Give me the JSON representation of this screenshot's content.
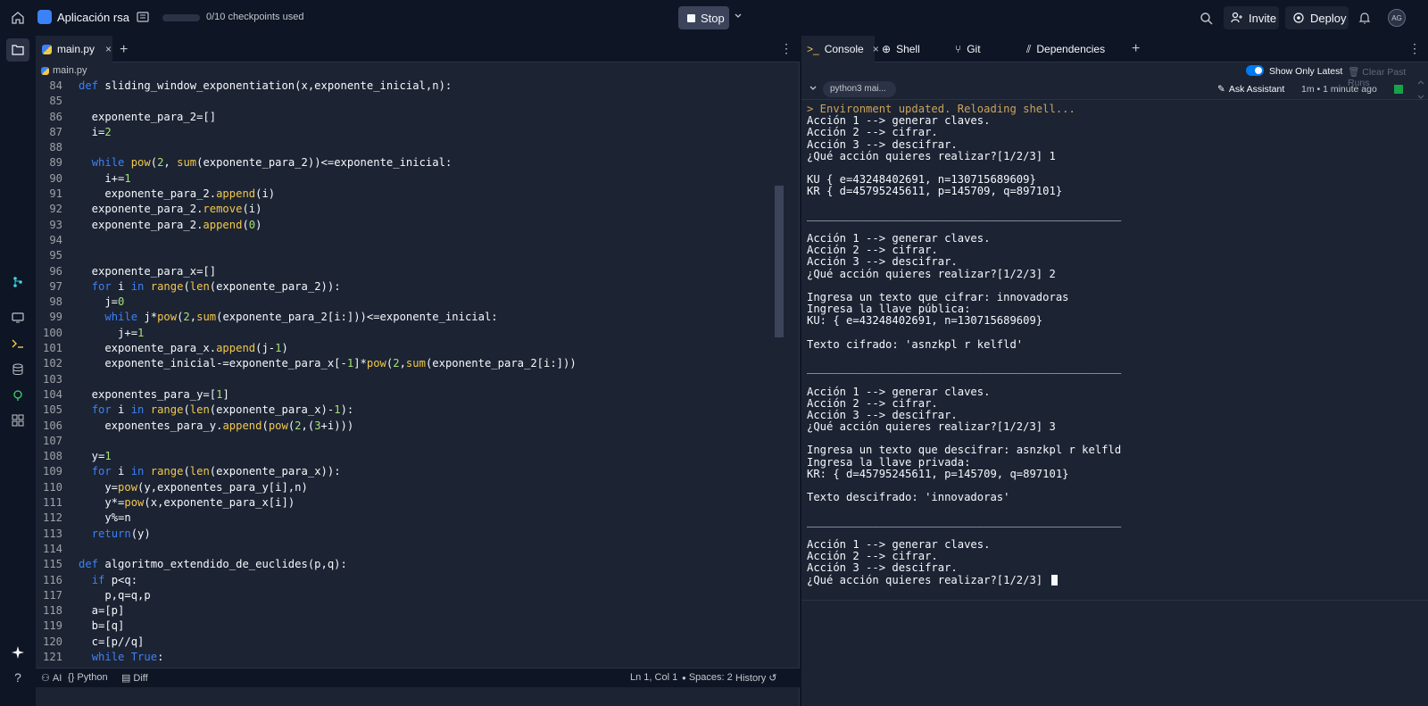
{
  "top": {
    "app_name": "Aplicación rsa",
    "checkpoints": "0/10 checkpoints used",
    "stop": "Stop",
    "invite": "Invite",
    "deploy": "Deploy",
    "avatar": "AG"
  },
  "editor": {
    "tab": "main.py",
    "breadcrumb": "main.py",
    "status": {
      "ai": "AI",
      "lang": "Python",
      "diff": "Diff",
      "position": "Ln 1, Col 1",
      "spaces": "Spaces: 2",
      "history": "History"
    },
    "lines": [
      {
        "n": "84",
        "t": "def sliding_window_exponentiation(x,exponente_inicial,n):"
      },
      {
        "n": "85",
        "t": ""
      },
      {
        "n": "86",
        "t": "  exponente_para_2=[]"
      },
      {
        "n": "87",
        "t": "  i=2"
      },
      {
        "n": "88",
        "t": ""
      },
      {
        "n": "89",
        "t": "  while pow(2, sum(exponente_para_2))<=exponente_inicial:"
      },
      {
        "n": "90",
        "t": "    i+=1"
      },
      {
        "n": "91",
        "t": "    exponente_para_2.append(i)"
      },
      {
        "n": "92",
        "t": "  exponente_para_2.remove(i)"
      },
      {
        "n": "93",
        "t": "  exponente_para_2.append(0)"
      },
      {
        "n": "94",
        "t": ""
      },
      {
        "n": "95",
        "t": ""
      },
      {
        "n": "96",
        "t": "  exponente_para_x=[]"
      },
      {
        "n": "97",
        "t": "  for i in range(len(exponente_para_2)):"
      },
      {
        "n": "98",
        "t": "    j=0"
      },
      {
        "n": "99",
        "t": "    while j*pow(2,sum(exponente_para_2[i:]))<=exponente_inicial:"
      },
      {
        "n": "100",
        "t": "      j+=1"
      },
      {
        "n": "101",
        "t": "    exponente_para_x.append(j-1)"
      },
      {
        "n": "102",
        "t": "    exponente_inicial-=exponente_para_x[-1]*pow(2,sum(exponente_para_2[i:]))"
      },
      {
        "n": "103",
        "t": ""
      },
      {
        "n": "104",
        "t": "  exponentes_para_y=[1]"
      },
      {
        "n": "105",
        "t": "  for i in range(len(exponente_para_x)-1):"
      },
      {
        "n": "106",
        "t": "    exponentes_para_y.append(pow(2,(3+i)))"
      },
      {
        "n": "107",
        "t": ""
      },
      {
        "n": "108",
        "t": "  y=1"
      },
      {
        "n": "109",
        "t": "  for i in range(len(exponente_para_x)):"
      },
      {
        "n": "110",
        "t": "    y=pow(y,exponentes_para_y[i],n)"
      },
      {
        "n": "111",
        "t": "    y*=pow(x,exponente_para_x[i])"
      },
      {
        "n": "112",
        "t": "    y%=n"
      },
      {
        "n": "113",
        "t": "  return(y)"
      },
      {
        "n": "114",
        "t": ""
      },
      {
        "n": "115",
        "t": "def algoritmo_extendido_de_euclides(p,q):"
      },
      {
        "n": "116",
        "t": "  if p<q:"
      },
      {
        "n": "117",
        "t": "    p,q=q,p"
      },
      {
        "n": "118",
        "t": "  a=[p]"
      },
      {
        "n": "119",
        "t": "  b=[q]"
      },
      {
        "n": "120",
        "t": "  c=[p//q]"
      },
      {
        "n": "121",
        "t": "  while True:"
      }
    ]
  },
  "right": {
    "tabs": [
      "Console",
      "Shell",
      "Git",
      "Dependencies"
    ],
    "show_only_latest": "Show Only Latest",
    "clear_past_runs": "Clear Past Runs",
    "session": "python3 mai...",
    "ask_assistant": "Ask Assistant",
    "time": "1m • 1 minute ago",
    "console_lines": [
      "> Environment updated. Reloading shell...",
      "Acción 1 --> generar claves.",
      "Acción 2 --> cifrar.",
      "Acción 3 --> descifrar.",
      "¿Qué acción quieres realizar?[1/2/3] 1",
      "",
      "KU { e=43248402691, n=130715689609}",
      "KR { d=45795245611, p=145709, q=897101}",
      "",
      "________________________________________________",
      "",
      "Acción 1 --> generar claves.",
      "Acción 2 --> cifrar.",
      "Acción 3 --> descifrar.",
      "¿Qué acción quieres realizar?[1/2/3] 2",
      "",
      "Ingresa un texto que cifrar: innovadoras",
      "Ingresa la llave pública:",
      "KU: { e=43248402691, n=130715689609}",
      "",
      "Texto cifrado: 'asnzkpl r kelfld'",
      "",
      "________________________________________________",
      "",
      "Acción 1 --> generar claves.",
      "Acción 2 --> cifrar.",
      "Acción 3 --> descifrar.",
      "¿Qué acción quieres realizar?[1/2/3] 3",
      "",
      "Ingresa un texto que descifrar: asnzkpl r kelfld",
      "Ingresa la llave privada:",
      "KR: { d=45795245611, p=145709, q=897101}",
      "",
      "Texto descifrado: 'innovadoras'",
      "",
      "________________________________________________",
      "",
      "Acción 1 --> generar claves.",
      "Acción 2 --> cifrar.",
      "Acción 3 --> descifrar.",
      "¿Qué acción quieres realizar?[1/2/3] "
    ]
  }
}
